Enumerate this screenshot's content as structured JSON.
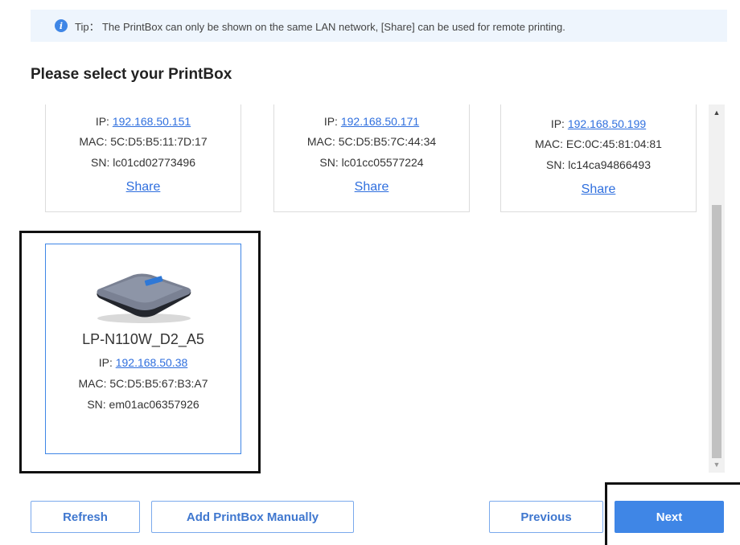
{
  "tip": {
    "icon": "info-icon",
    "text": "Tip： The PrintBox can only be shown on the same LAN network, [Share] can be used for remote printing."
  },
  "heading": "Please select your PrintBox",
  "devices": [
    {
      "ip_label": "IP:",
      "ip": "192.168.50.151",
      "mac": "MAC: 5C:D5:B5:11:7D:17",
      "sn": "SN: lc01cd02773496",
      "share": "Share"
    },
    {
      "ip_label": "IP:",
      "ip": "192.168.50.171",
      "mac": "MAC: 5C:D5:B5:7C:44:34",
      "sn": "SN: lc01cc05577224",
      "share": "Share"
    },
    {
      "ip_label": "IP:",
      "ip": "192.168.50.199",
      "mac": "MAC: EC:0C:45:81:04:81",
      "sn": "SN: lc14ca94866493",
      "share": "Share"
    }
  ],
  "selected_device": {
    "name": "LP-N110W_D2_A5",
    "ip_label": "IP:",
    "ip": "192.168.50.38",
    "mac": "MAC: 5C:D5:B5:67:B3:A7",
    "sn": "SN: em01ac06357926"
  },
  "buttons": {
    "refresh": "Refresh",
    "add_manually": "Add PrintBox Manually",
    "previous": "Previous",
    "next": "Next"
  },
  "colors": {
    "accent": "#3f86e6",
    "tip_background": "#eef5fd",
    "link": "#2f6fde"
  }
}
